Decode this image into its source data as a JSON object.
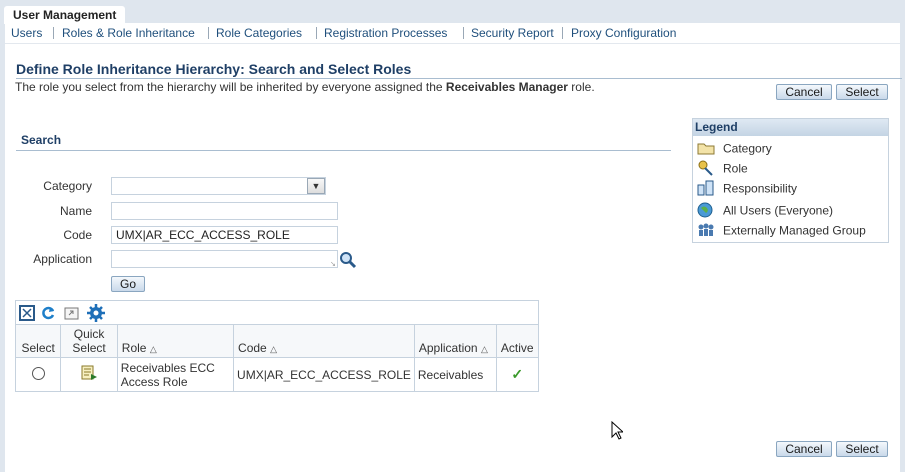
{
  "app_tab": "User Management",
  "nav": [
    "Users",
    "Roles & Role Inheritance",
    "Role Categories",
    "Registration Processes",
    "Security Report",
    "Proxy Configuration"
  ],
  "page": {
    "title": "Define Role Inheritance Hierarchy: Search and Select Roles",
    "desc_prefix": "The role you select from the hierarchy will be inherited by everyone assigned the ",
    "desc_role": "Receivables Manager",
    "desc_suffix": " role."
  },
  "buttons": {
    "cancel": "Cancel",
    "select": "Select",
    "go": "Go"
  },
  "search": {
    "header": "Search",
    "labels": {
      "category": "Category",
      "name": "Name",
      "code": "Code",
      "application": "Application"
    },
    "values": {
      "category": "",
      "name": "",
      "code": "UMX|AR_ECC_ACCESS_ROLE",
      "application": ""
    }
  },
  "legend": {
    "header": "Legend",
    "items": [
      {
        "label": "Category",
        "icon": "folder-icon"
      },
      {
        "label": "Role",
        "icon": "role-keys-icon"
      },
      {
        "label": "Responsibility",
        "icon": "responsibility-icon"
      },
      {
        "label": "All Users (Everyone)",
        "icon": "globe-icon"
      },
      {
        "label": "Externally Managed Group",
        "icon": "group-icon"
      }
    ]
  },
  "table": {
    "headers": {
      "select": "Select",
      "quick_select": "Quick Select",
      "role": "Role",
      "code": "Code",
      "application": "Application",
      "active": "Active"
    },
    "rows": [
      {
        "role": "Receivables ECC Access Role",
        "code": "UMX|AR_ECC_ACCESS_ROLE",
        "application": "Receivables",
        "active": "✓"
      }
    ]
  },
  "colors": {
    "link": "#1f4f7c",
    "title": "#1f3f66",
    "check": "#3a9a2a"
  }
}
